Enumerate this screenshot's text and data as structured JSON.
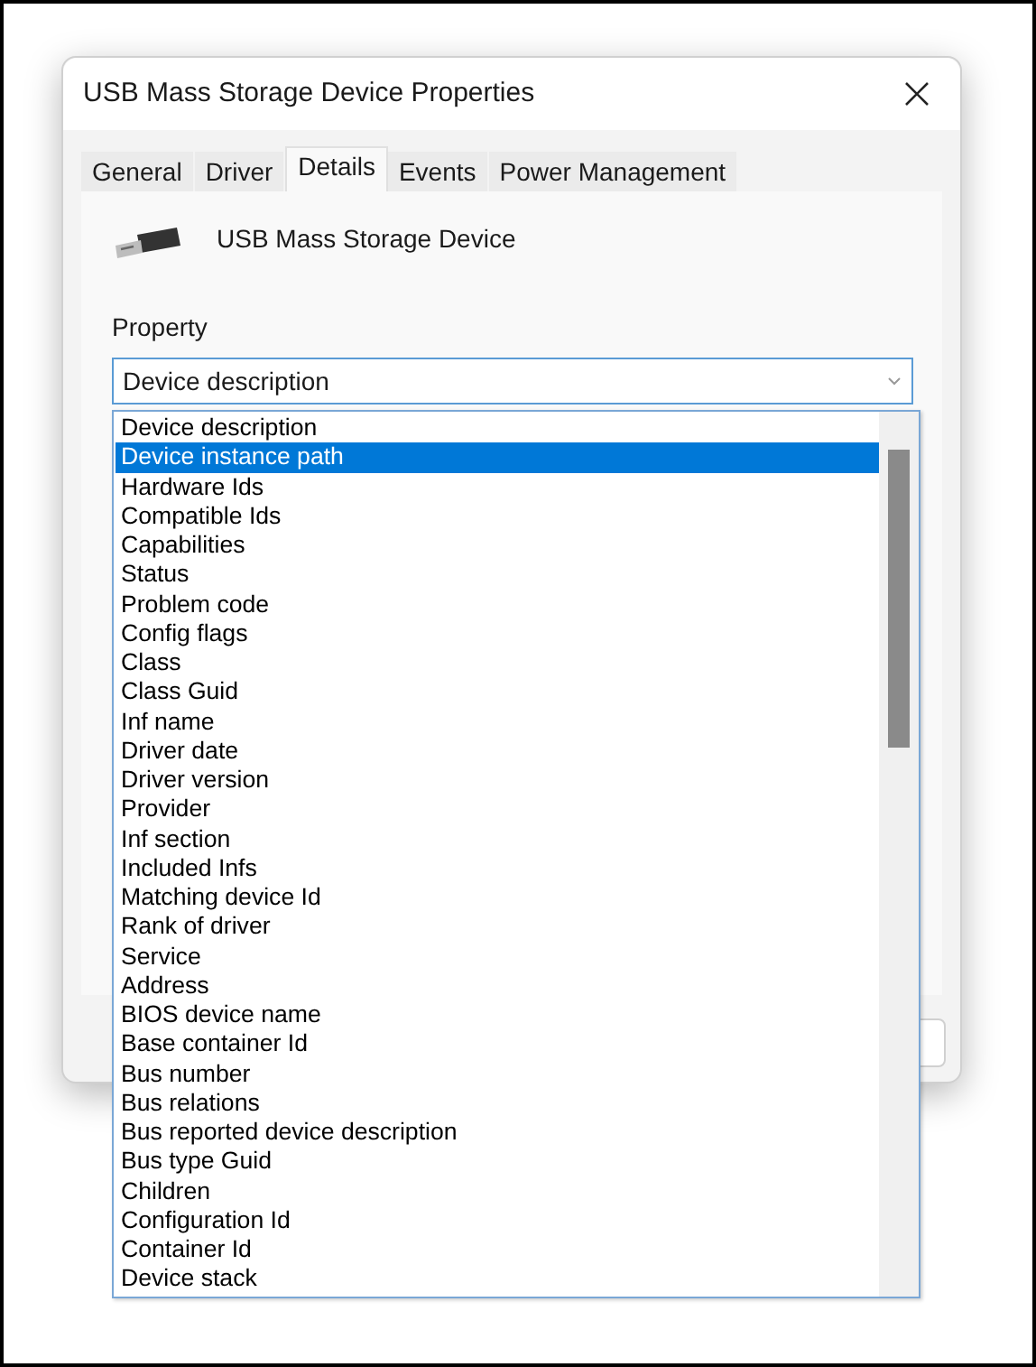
{
  "window": {
    "title": "USB Mass Storage Device Properties"
  },
  "tabs": [
    {
      "label": "General",
      "selected": false
    },
    {
      "label": "Driver",
      "selected": false
    },
    {
      "label": "Details",
      "selected": true
    },
    {
      "label": "Events",
      "selected": false
    },
    {
      "label": "Power Management",
      "selected": false
    }
  ],
  "device": {
    "name": "USB Mass Storage Device"
  },
  "property": {
    "label": "Property",
    "value": "Device description",
    "options": [
      {
        "label": "Device description",
        "highlighted": false
      },
      {
        "label": "Device instance path",
        "highlighted": true
      },
      {
        "label": "Hardware Ids",
        "highlighted": false
      },
      {
        "label": "Compatible Ids",
        "highlighted": false
      },
      {
        "label": "Capabilities",
        "highlighted": false
      },
      {
        "label": "Status",
        "highlighted": false
      },
      {
        "label": "Problem code",
        "highlighted": false
      },
      {
        "label": "Config flags",
        "highlighted": false
      },
      {
        "label": "Class",
        "highlighted": false
      },
      {
        "label": "Class Guid",
        "highlighted": false
      },
      {
        "label": "Inf name",
        "highlighted": false
      },
      {
        "label": "Driver date",
        "highlighted": false
      },
      {
        "label": "Driver version",
        "highlighted": false
      },
      {
        "label": "Provider",
        "highlighted": false
      },
      {
        "label": "Inf section",
        "highlighted": false
      },
      {
        "label": "Included Infs",
        "highlighted": false
      },
      {
        "label": "Matching device Id",
        "highlighted": false
      },
      {
        "label": "Rank of driver",
        "highlighted": false
      },
      {
        "label": "Service",
        "highlighted": false
      },
      {
        "label": "Address",
        "highlighted": false
      },
      {
        "label": "BIOS device name",
        "highlighted": false
      },
      {
        "label": "Base container Id",
        "highlighted": false
      },
      {
        "label": "Bus number",
        "highlighted": false
      },
      {
        "label": "Bus relations",
        "highlighted": false
      },
      {
        "label": "Bus reported device description",
        "highlighted": false
      },
      {
        "label": "Bus type Guid",
        "highlighted": false
      },
      {
        "label": "Children",
        "highlighted": false
      },
      {
        "label": "Configuration Id",
        "highlighted": false
      },
      {
        "label": "Container Id",
        "highlighted": false
      },
      {
        "label": "Device stack",
        "highlighted": false
      }
    ]
  }
}
